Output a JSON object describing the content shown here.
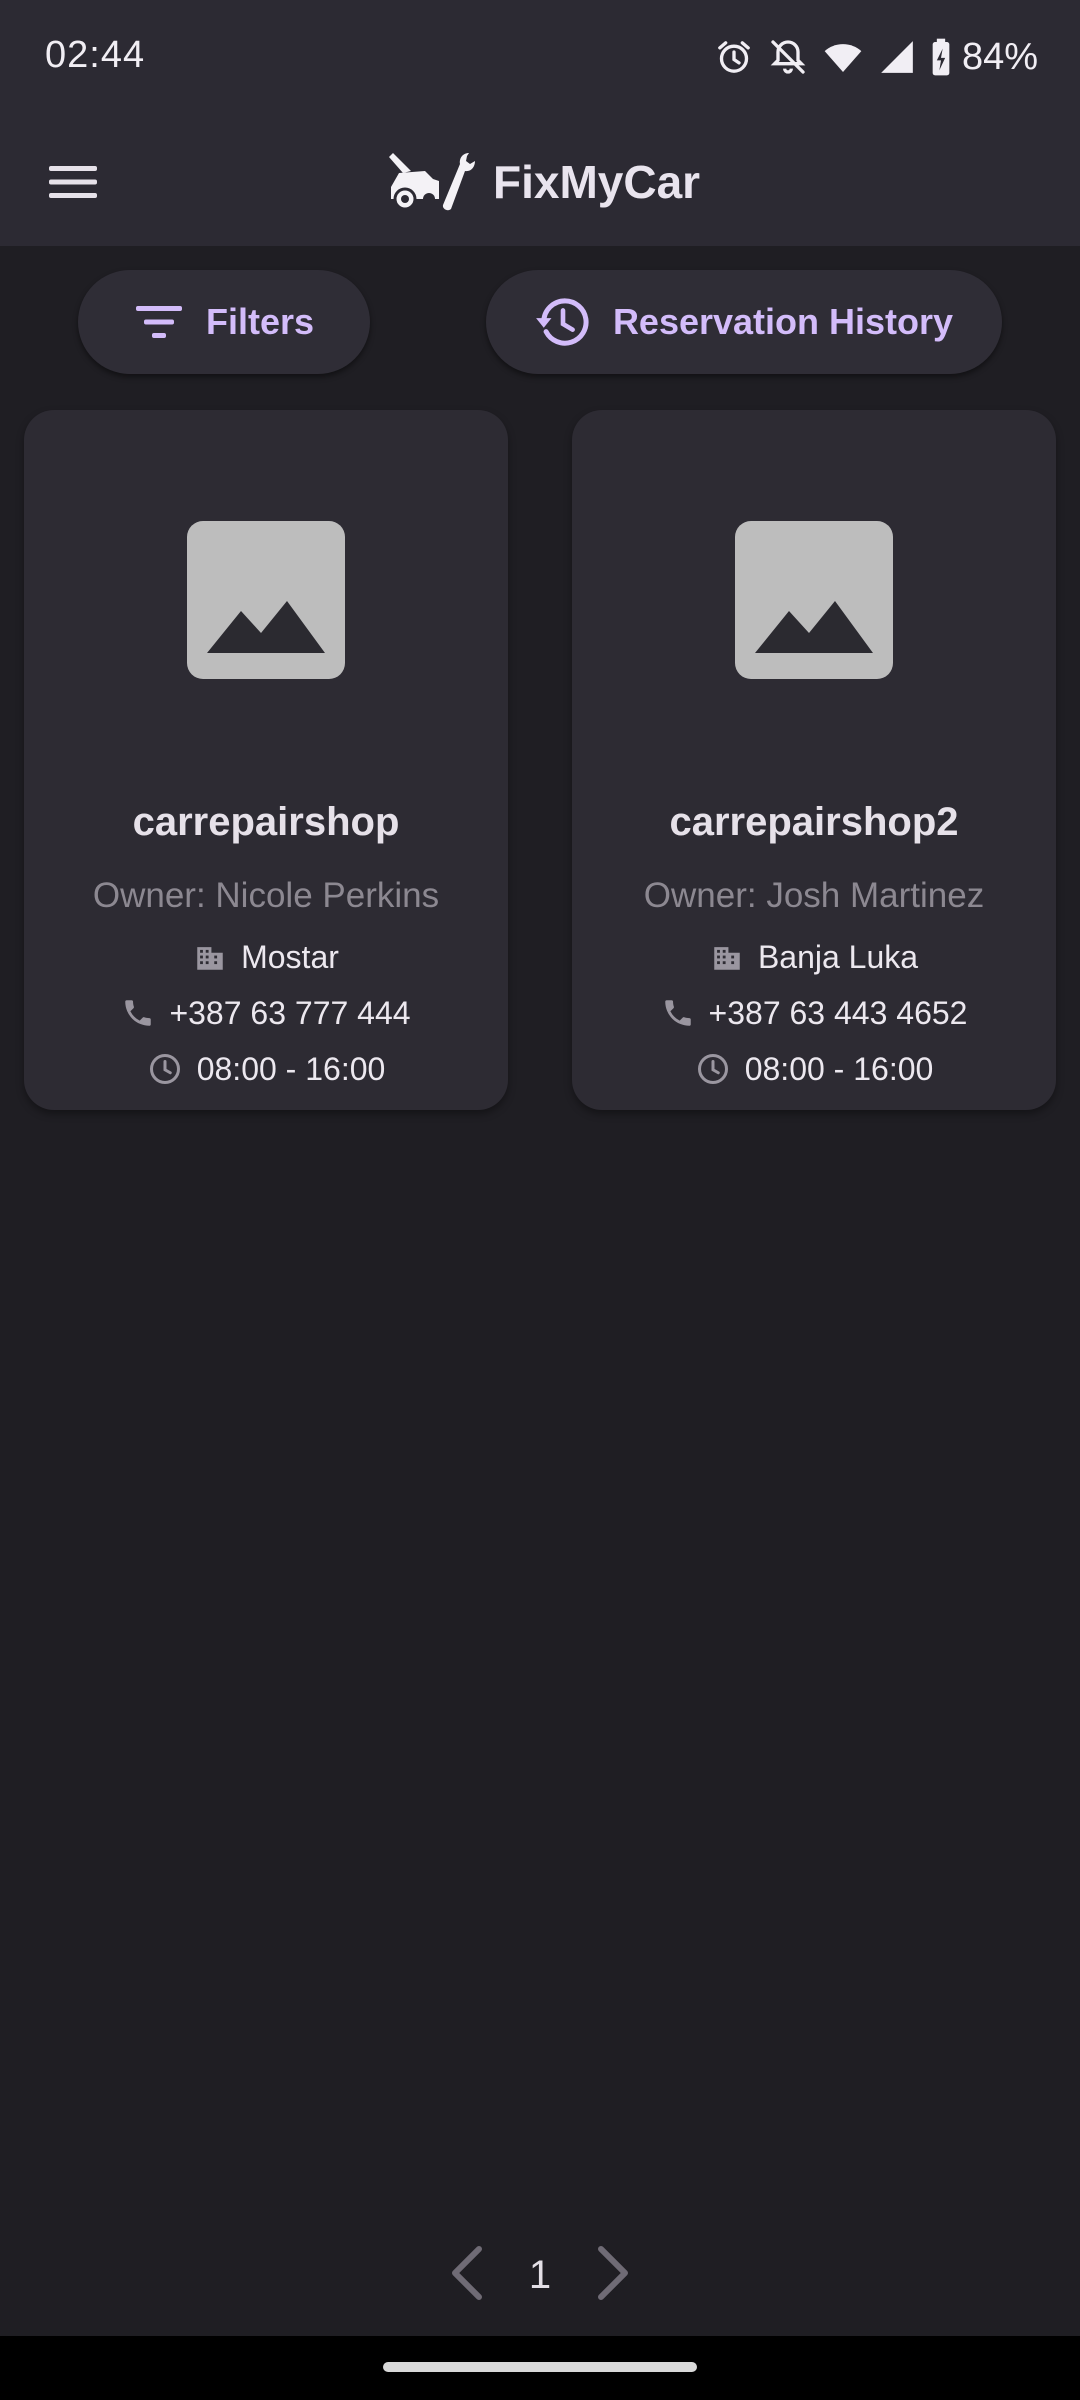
{
  "status_bar": {
    "time": "02:44",
    "battery": "84%",
    "icons": [
      "alarm-icon",
      "notifications-off-icon",
      "wifi-icon",
      "signal-icon",
      "battery-charging-icon"
    ]
  },
  "app_bar": {
    "title": "FixMyCar",
    "menu_icon": "menu-icon",
    "logo_icon": "car-repair-logo"
  },
  "actions": {
    "filters_label": "Filters",
    "filters_icon": "filter-icon",
    "history_label": "Reservation History",
    "history_icon": "history-icon"
  },
  "shops": [
    {
      "name": "carrepairshop",
      "owner": "Owner: Nicole Perkins",
      "city": "Mostar",
      "phone": "+387 63 777 444",
      "hours": "08:00 - 16:00"
    },
    {
      "name": "carrepairshop2",
      "owner": "Owner: Josh Martinez",
      "city": "Banja Luka",
      "phone": "+387 63 443 4652",
      "hours": "08:00 - 16:00"
    }
  ],
  "pagination": {
    "current_page": "1"
  },
  "colors": {
    "background": "#1f1e23",
    "surface": "#2d2b33",
    "accent": "#d3bcfa",
    "muted_text": "#8c8891"
  }
}
